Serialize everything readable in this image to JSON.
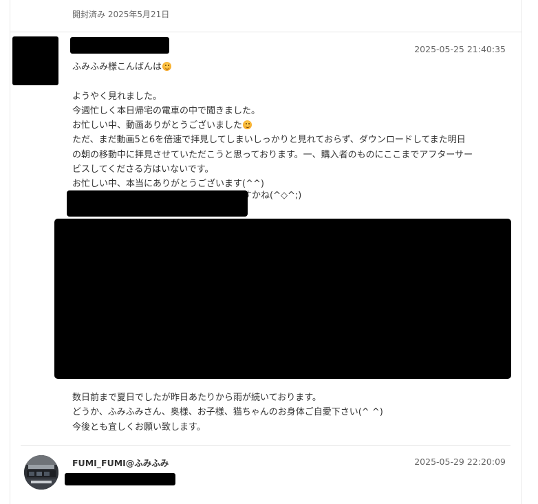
{
  "header": {
    "opened_note": "開封済み 2025年5月21日"
  },
  "messages": [
    {
      "timestamp": "2025-05-25 21:40:35",
      "lines": [
        "ふみふみ様こんばんは",
        "",
        "ようやく見れました。",
        "今週忙しく本日帰宅の電車の中で聞きました。",
        "お忙しい中、動画ありがとうございました",
        "ただ、まだ動画5と6を倍速で拝見してしまいしっかりと見れておらず、ダウンロードしてまた明日",
        "の朝の移動中に拝見させていただこうと思っております。一、購入者のものにここまでアフターサー",
        "ビスしてくださる方はいないです。",
        "お忙しい中、本当にありがとうございます(^^)"
      ],
      "partial_line_visible": "すかね(^◇^;)",
      "closing_lines": [
        "数日前まで夏日でしたが昨日あたりから雨が続いております。",
        "どうか、ふみふみさん、奥様、お子様、猫ちゃんのお身体ご自愛下さい(^ ^)",
        "今後とも宜しくお願い致します。"
      ],
      "emoji_icon": "smiling-face-emoji"
    },
    {
      "sender": "FUMI_FUMI@ふみふみ",
      "timestamp": "2025-05-29 22:20:09"
    }
  ],
  "colors": {
    "text": "#333333",
    "muted": "#666666",
    "divider": "#e6e6e6",
    "redaction": "#000000"
  }
}
